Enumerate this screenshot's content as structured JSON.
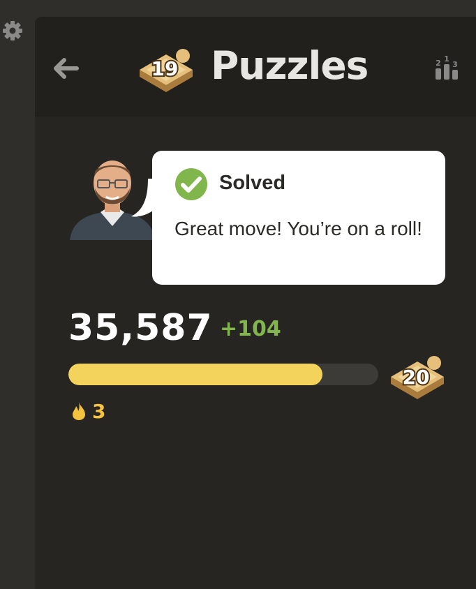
{
  "header": {
    "title": "Puzzles",
    "current_level": "19"
  },
  "bubble": {
    "title": "Solved",
    "message": "Great move! You’re on a roll!"
  },
  "stats": {
    "rating": "35,587",
    "rating_change": "+104",
    "progress_fraction": 0.82,
    "next_level": "20",
    "streak": "3"
  },
  "colors": {
    "accent_green": "#81b64c",
    "progress_yellow": "#f3d35b",
    "streak_gold": "#f3c23e"
  },
  "icons": {
    "settings": "gear-icon",
    "back": "arrow-left-icon",
    "leaderboard": "leaderboard-icon",
    "status": "checkmark-icon",
    "streak": "flame-icon"
  }
}
